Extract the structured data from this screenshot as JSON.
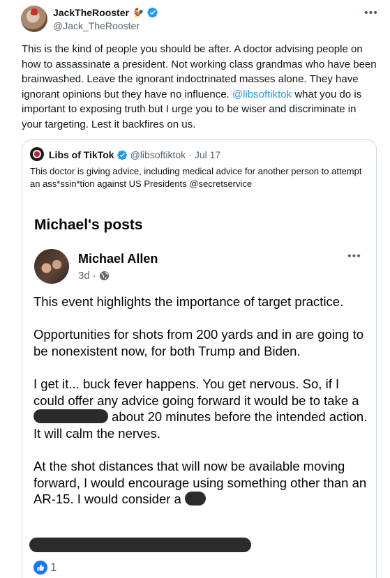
{
  "tweet": {
    "author": {
      "display_name": "JackTheRooster",
      "name_emoji": "🐓",
      "handle": "@Jack_TheRooster",
      "verified": true
    },
    "more_icon": "more-horizontal-icon",
    "text_before_mention": "This is the kind of people you should be after. A doctor advising people on how to assassinate a president. Not working class grandmas who have been brainwashed. Leave the ignorant indoctrinated masses alone. They have ignorant opinions but they have no influence. ",
    "mention": "@libsoftiktok",
    "text_after_mention": " what you do is important to exposing truth but I urge you to be wiser and discriminate in your targeting. Lest it backfires on us."
  },
  "quoted_tweet": {
    "author": {
      "display_name": "Libs of TikTok",
      "handle": "@libsoftiktok",
      "date": "Jul 17",
      "verified": true
    },
    "separator": "·",
    "text": "This doctor is giving advice, including medical advice for another person to attempt an ass*ssin*tion against US Presidents @secretservice",
    "media": {
      "header": "Michael's posts",
      "post_author": "Michael Allen",
      "post_time": "3d",
      "time_separator": "·",
      "privacy_icon": "globe-icon",
      "paragraphs": {
        "p1": "This event highlights the importance of target practice.",
        "p2": "Opportunities for shots from 200 yards and in are going to be nonexistent now, for both Trump and Biden.",
        "p3_a": "I get it... buck fever happens.  You get nervous.  So, if I could offer any advice going forward it would be to take a ",
        "p3_b": " about 20 minutes before the intended action.  It will calm the nerves.",
        "p4": "At the shot distances that will now be available moving forward, I would encourage using something other than an AR-15.  I would consider a "
      },
      "reaction_count": "1",
      "reaction_icon": "thumbs-up-icon"
    }
  },
  "colors": {
    "link": "#1d9bf0",
    "verified": "#1d9bf0",
    "secondary_text": "#536471",
    "facebook_blue": "#1877f2",
    "redaction": "#2b2b2b"
  }
}
